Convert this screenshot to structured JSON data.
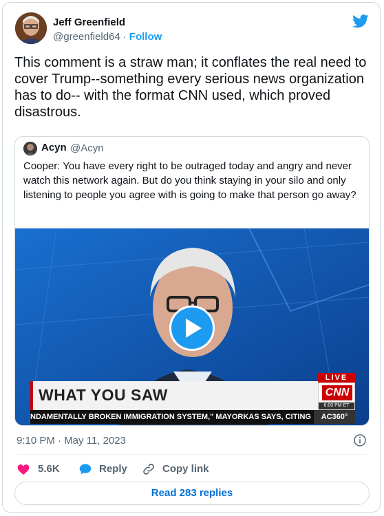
{
  "author": {
    "name": "Jeff Greenfield",
    "handle": "@greenfield64",
    "separator": "·",
    "follow_label": "Follow"
  },
  "tweet_text": "This comment is a straw man; it conflates the real need to cover Trump--something every serious news organization has to do-- with the format CNN used, which proved disastrous.",
  "quoted": {
    "name": "Acyn",
    "handle": "@Acyn",
    "text": "Cooper: You have every right to be outraged today and angry and never watch this network again. But do you think staying in your silo and only listening to people you agree with is going to make that person go away?",
    "video": {
      "lower_third": "WHAT YOU SAW",
      "live_label": "LIVE",
      "network_logo": "CNN",
      "time_label": "6:00 PM ET",
      "ticker": "NDAMENTALLY BROKEN IMMIGRATION SYSTEM,\" MAYORKAS SAYS, CITING",
      "show_tag": "AC360°"
    }
  },
  "timestamp": "9:10 PM · May 11, 2023",
  "actions": {
    "likes": "5.6K",
    "reply": "Reply",
    "copy_link": "Copy link"
  },
  "read_replies": "Read 283 replies",
  "colors": {
    "accent": "#1d9bf0",
    "like": "#f91880",
    "text": "#0f1419",
    "muted": "#536471"
  },
  "icons": [
    "twitter-bird-icon",
    "play-icon",
    "info-icon",
    "heart-icon",
    "reply-icon",
    "link-icon"
  ]
}
